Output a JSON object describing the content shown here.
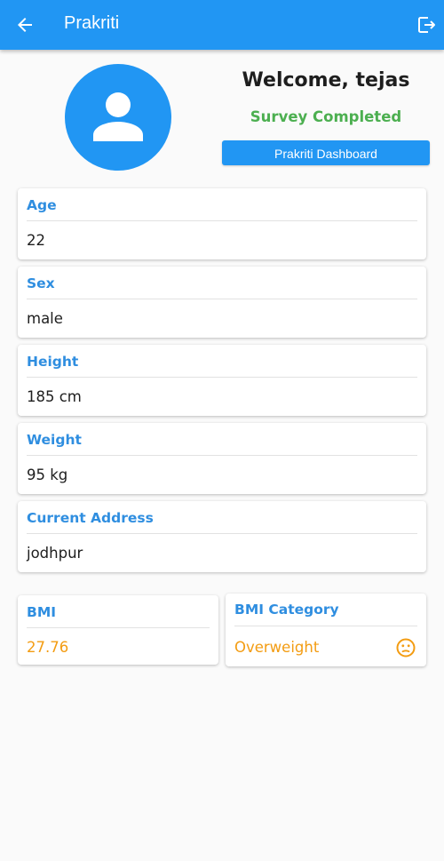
{
  "appbar": {
    "title": "Prakriti",
    "back_icon": "arrow-left-icon",
    "logout_icon": "logout-icon",
    "color": "#2196f3"
  },
  "profile": {
    "avatar_icon": "person-icon",
    "welcome": "Welcome, tejas",
    "survey_status": "Survey Completed",
    "survey_status_color": "#4caf50",
    "dashboard_button": "Prakriti Dashboard"
  },
  "details": [
    {
      "label": "Age",
      "value": "22"
    },
    {
      "label": "Sex",
      "value": "male"
    },
    {
      "label": "Height",
      "value": "185 cm"
    },
    {
      "label": "Weight",
      "value": "95 kg"
    },
    {
      "label": "Current Address",
      "value": "jodhpur"
    }
  ],
  "bmi": {
    "label": "BMI",
    "value": "27.76",
    "category_label": "BMI Category",
    "category_value": "Overweight",
    "category_icon": "neutral-face-icon",
    "value_color": "#f39c12"
  }
}
